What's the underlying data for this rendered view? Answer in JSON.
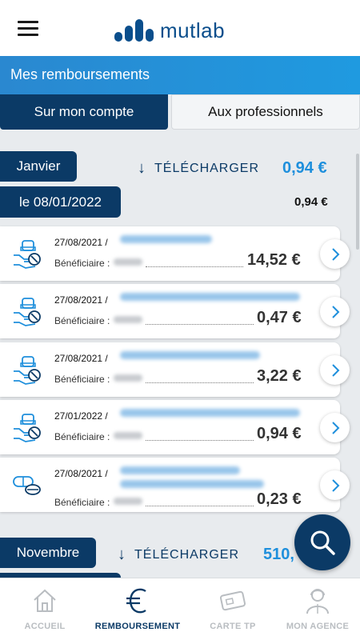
{
  "header": {
    "brand": "mutlab",
    "menu_icon": "hamburger-menu-icon"
  },
  "section": {
    "title": "Mes remboursements"
  },
  "tabs": [
    {
      "label": "Sur mon compte",
      "active": true
    },
    {
      "label": "Aux professionnels",
      "active": false
    }
  ],
  "months": [
    {
      "label": "Janvier",
      "download_label": "TÉLÉCHARGER",
      "total": "0,94 €"
    },
    {
      "label": "Novembre",
      "download_label": "TÉLÉCHARGER",
      "total": "510,"
    }
  ],
  "date_group": {
    "label": "le 08/01/2022",
    "total": "0,94 €"
  },
  "items": [
    {
      "date": "27/08/2021 /",
      "beneficiary_label": "Bénéficiaire :",
      "amount": "14,52 €",
      "icon": "medicine-hand-icon"
    },
    {
      "date": "27/08/2021 /",
      "beneficiary_label": "Bénéficiaire :",
      "amount": "0,47 €",
      "icon": "medicine-hand-icon"
    },
    {
      "date": "27/08/2021 /",
      "beneficiary_label": "Bénéficiaire :",
      "amount": "3,22 €",
      "icon": "medicine-hand-icon"
    },
    {
      "date": "27/01/2022 /",
      "beneficiary_label": "Bénéficiaire :",
      "amount": "0,94 €",
      "icon": "medicine-hand-icon"
    },
    {
      "date": "27/08/2021 /",
      "beneficiary_label": "Bénéficiaire :",
      "amount": "0,23 €",
      "icon": "pills-icon"
    }
  ],
  "bottom_nav": [
    {
      "label": "ACCUEIL",
      "icon": "home-icon",
      "active": false
    },
    {
      "label": "REMBOURSEMENT",
      "icon": "euro-icon",
      "active": true
    },
    {
      "label": "CARTE TP",
      "icon": "card-icon",
      "active": false
    },
    {
      "label": "MON AGENCE",
      "icon": "agent-icon",
      "active": false
    }
  ],
  "colors": {
    "primary": "#0b3a66",
    "accent": "#1e8fdc",
    "header_bar": "#2a88d0"
  }
}
